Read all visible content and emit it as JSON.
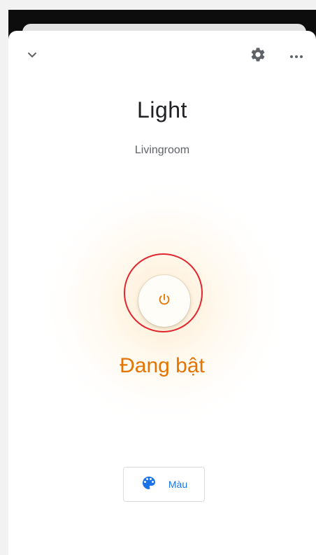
{
  "device": {
    "name": "Light",
    "room": "Livingroom",
    "state_label": "Đang bật"
  },
  "toolbar": {
    "collapse_icon": "chevron-down-icon",
    "settings_icon": "gear-icon",
    "more_icon": "more-horizontal-icon"
  },
  "controls": {
    "power_icon": "power-icon",
    "color_icon": "palette-icon",
    "color_label": "Màu"
  },
  "colors": {
    "accent_on": "#e37400",
    "link_blue": "#1a73e8",
    "highlight_ring": "#e1262f"
  }
}
